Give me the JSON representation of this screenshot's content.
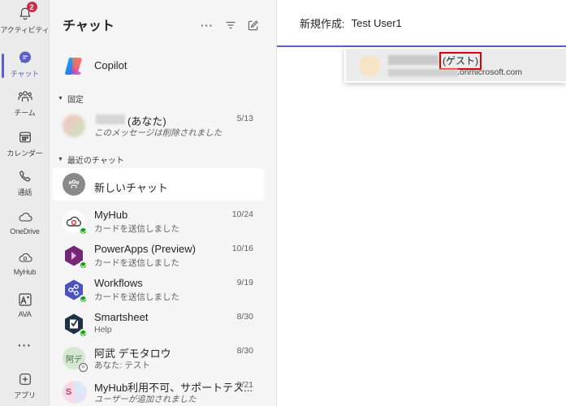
{
  "rail": {
    "items": [
      {
        "label": "アクティビティ",
        "icon": "bell-icon",
        "badge": "2"
      },
      {
        "label": "チャット",
        "icon": "chat-icon"
      },
      {
        "label": "チーム",
        "icon": "teams-icon"
      },
      {
        "label": "カレンダー",
        "icon": "calendar-icon"
      },
      {
        "label": "通話",
        "icon": "phone-icon"
      },
      {
        "label": "OneDrive",
        "icon": "cloud-icon"
      },
      {
        "label": "MyHub",
        "icon": "myhub-icon"
      },
      {
        "label": "AVA",
        "icon": "ava-icon"
      },
      {
        "label": "",
        "icon": "more-icon"
      },
      {
        "label": "アプリ",
        "icon": "add-apps-icon"
      }
    ],
    "accent": "#5b5fc7"
  },
  "panel": {
    "title": "チャット",
    "more": "···",
    "copilot": {
      "name": "Copilot"
    },
    "pinned_label": "固定",
    "pinned": [
      {
        "name": "(あなた)",
        "sub": "このメッセージは削除されました",
        "date": "5/13"
      }
    ],
    "recent_label": "最近のチャット",
    "new_chat": {
      "name": "新しいチャット"
    },
    "chats": [
      {
        "name": "MyHub",
        "sub": "カードを送信しました",
        "date": "10/24"
      },
      {
        "name": "PowerApps (Preview)",
        "sub": "カードを送信しました",
        "date": "10/16"
      },
      {
        "name": "Workflows",
        "sub": "カードを送信しました",
        "date": "9/19"
      },
      {
        "name": "Smartsheet",
        "sub": "Help",
        "date": "8/30"
      },
      {
        "name": "阿武 デモタロウ",
        "sub": "あなた: テスト",
        "date": "8/30",
        "avatar": "阿デ"
      },
      {
        "name": "MyHub利用不可、サポートテス...",
        "sub": "ユーザーが追加されました",
        "date": "8/21",
        "avatar": "S"
      }
    ]
  },
  "main": {
    "to_label": "新規作成:",
    "to_value": "Test User1",
    "suggestion": {
      "guest_tag": "(ゲスト)",
      "email_suffix": ".onmicrosoft.com"
    }
  }
}
